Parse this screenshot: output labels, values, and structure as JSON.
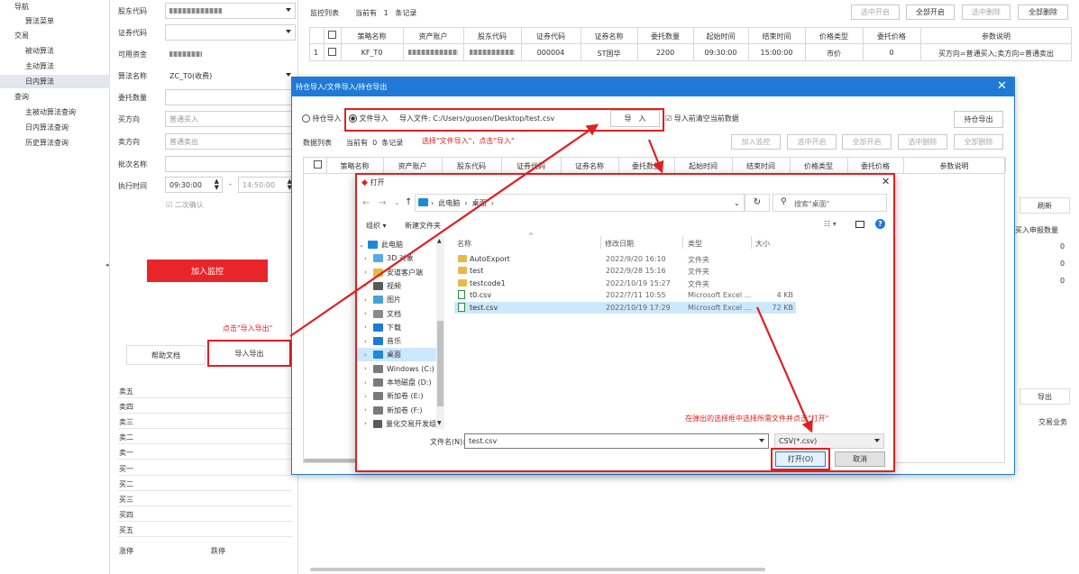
{
  "nav": {
    "items": [
      {
        "label": "导航",
        "indent": false
      },
      {
        "label": "算法菜单",
        "indent": true
      },
      {
        "label": "交易",
        "indent": false
      },
      {
        "label": "被动算法",
        "indent": true
      },
      {
        "label": "主动算法",
        "indent": true
      },
      {
        "label": "日内算法",
        "indent": true,
        "selected": true
      },
      {
        "label": "查询",
        "indent": false
      },
      {
        "label": "主被动算法查询",
        "indent": true
      },
      {
        "label": "日内算法查询",
        "indent": true
      },
      {
        "label": "历史算法查询",
        "indent": true
      }
    ]
  },
  "form": {
    "shareholder_label": "股东代码",
    "account_label": "证券代码",
    "available_label": "可用资金",
    "algo_label": "算法名称",
    "algo_value": "ZC_T0(收费)",
    "qty_label": "委托数量",
    "buy_label": "买方向",
    "buy_value": "普通买入",
    "sell_label": "卖方向",
    "sell_value": "普通卖出",
    "batch_label": "批次名称",
    "time_label": "执行时间",
    "start_time": "09:30:00",
    "end_time": "14:50:00",
    "time_dash": "-",
    "confirm_label": "二次确认",
    "add_monitor": "加入监控",
    "help_doc": "帮助文档",
    "import_export": "导入导出",
    "annotation_import_export": "点击\"导入导出\""
  },
  "orderbook": {
    "rows": [
      "卖五",
      "卖四",
      "卖三",
      "卖二",
      "卖一",
      "买一",
      "买二",
      "买三",
      "买四",
      "买五"
    ],
    "rise": "涨停",
    "fall": "跌停"
  },
  "monitor": {
    "title": "监控列表",
    "count_prefix": "当前有",
    "count": "1",
    "count_suffix": "条记录",
    "buttons": [
      "选中开启",
      "全部开启",
      "选中删除",
      "全部删除"
    ],
    "headers": [
      "策略名称",
      "资产账户",
      "股东代码",
      "证券代码",
      "证券名称",
      "委托数量",
      "起始时间",
      "结束时间",
      "价格类型",
      "委托价格",
      "参数说明"
    ],
    "row": {
      "index": "1",
      "strategy": "KF_T0",
      "code": "000004",
      "name": "ST国华",
      "qty": "2200",
      "start": "09:30:00",
      "end": "15:00:00",
      "ptype": "市价",
      "price": "0",
      "params": "买方向=普通买入;卖方向=普通卖出"
    }
  },
  "right": {
    "refresh": "刷新",
    "qty_header": "买入申报数量",
    "values": [
      "0",
      "0",
      "0"
    ],
    "export": "导出",
    "biz": "交易业务"
  },
  "dialog": {
    "title": "持仓导入/文件导入/持仓导出",
    "radio_position": "持仓导入",
    "radio_file": "文件导入",
    "file_label": "导入文件:",
    "file_path": "C:/Users/guosen/Desktop/test.csv",
    "import_btn": "导　入",
    "clear_label": "导入前清空当前数据",
    "export_btn": "持仓导出",
    "data_list": "数据列表",
    "count_prefix": "当前有",
    "count": "0",
    "count_suffix": "条记录",
    "annotation": "选择\"文件导入\"，点击\"导入\"",
    "buttons": [
      "加入监控",
      "选中开启",
      "全部开启",
      "选中删除",
      "全部删除"
    ],
    "headers": [
      "策略名称",
      "资产账户",
      "股东代码",
      "证券代码",
      "证券名称",
      "委托数量",
      "起始时间",
      "结束时间",
      "价格类型",
      "委托价格",
      "参数说明"
    ]
  },
  "open_dialog": {
    "title": "打开",
    "breadcrumb": [
      "此电脑",
      "桌面"
    ],
    "search_placeholder": "搜索\"桌面\"",
    "organize": "组织 ▾",
    "new_folder": "新建文件夹",
    "tree": [
      {
        "label": "此电脑",
        "icon": "pc",
        "level": 0,
        "expanded": true
      },
      {
        "label": "3D 对象",
        "icon": "folder3d",
        "level": 1
      },
      {
        "label": "安道客户端",
        "icon": "folder",
        "level": 1
      },
      {
        "label": "视频",
        "icon": "video",
        "level": 1
      },
      {
        "label": "图片",
        "icon": "picture",
        "level": 1
      },
      {
        "label": "文档",
        "icon": "doc",
        "level": 1
      },
      {
        "label": "下载",
        "icon": "download",
        "level": 1
      },
      {
        "label": "音乐",
        "icon": "music",
        "level": 1
      },
      {
        "label": "桌面",
        "icon": "desktop",
        "level": 1,
        "selected": true
      },
      {
        "label": "Windows (C:)",
        "icon": "drive",
        "level": 1
      },
      {
        "label": "本地磁盘 (D:)",
        "icon": "drive",
        "level": 1
      },
      {
        "label": "新加卷 (E:)",
        "icon": "drive",
        "level": 1
      },
      {
        "label": "新加卷 (F:)",
        "icon": "drive",
        "level": 1
      },
      {
        "label": "量化交易开发组",
        "icon": "netdrive",
        "level": 1
      }
    ],
    "columns": [
      "名称",
      "修改日期",
      "类型",
      "大小"
    ],
    "files": [
      {
        "name": "AutoExport",
        "date": "2022/9/20 16:10",
        "type": "文件夹",
        "size": "",
        "icon": "folder"
      },
      {
        "name": "test",
        "date": "2022/9/28 15:16",
        "type": "文件夹",
        "size": "",
        "icon": "folder"
      },
      {
        "name": "testcode1",
        "date": "2022/10/19 15:27",
        "type": "文件夹",
        "size": "",
        "icon": "folder"
      },
      {
        "name": "t0.csv",
        "date": "2022/7/11 10:55",
        "type": "Microsoft Excel ...",
        "size": "4 KB",
        "icon": "csv"
      },
      {
        "name": "test.csv",
        "date": "2022/10/19 17:29",
        "type": "Microsoft Excel ...",
        "size": "72 KB",
        "icon": "csv",
        "selected": true
      }
    ],
    "annotation": "在弹出的选择框中选择所需文件并点击\"打开\"",
    "filename_label": "文件名(N):",
    "filename_value": "test.csv",
    "filetype_value": "CSV(*.csv)",
    "open_btn": "打开(O)",
    "cancel_btn": "取消"
  },
  "colors": {
    "accent_red": "#e02020",
    "dialog_blue": "#1e7ad6",
    "add_btn": "#e8262a"
  }
}
